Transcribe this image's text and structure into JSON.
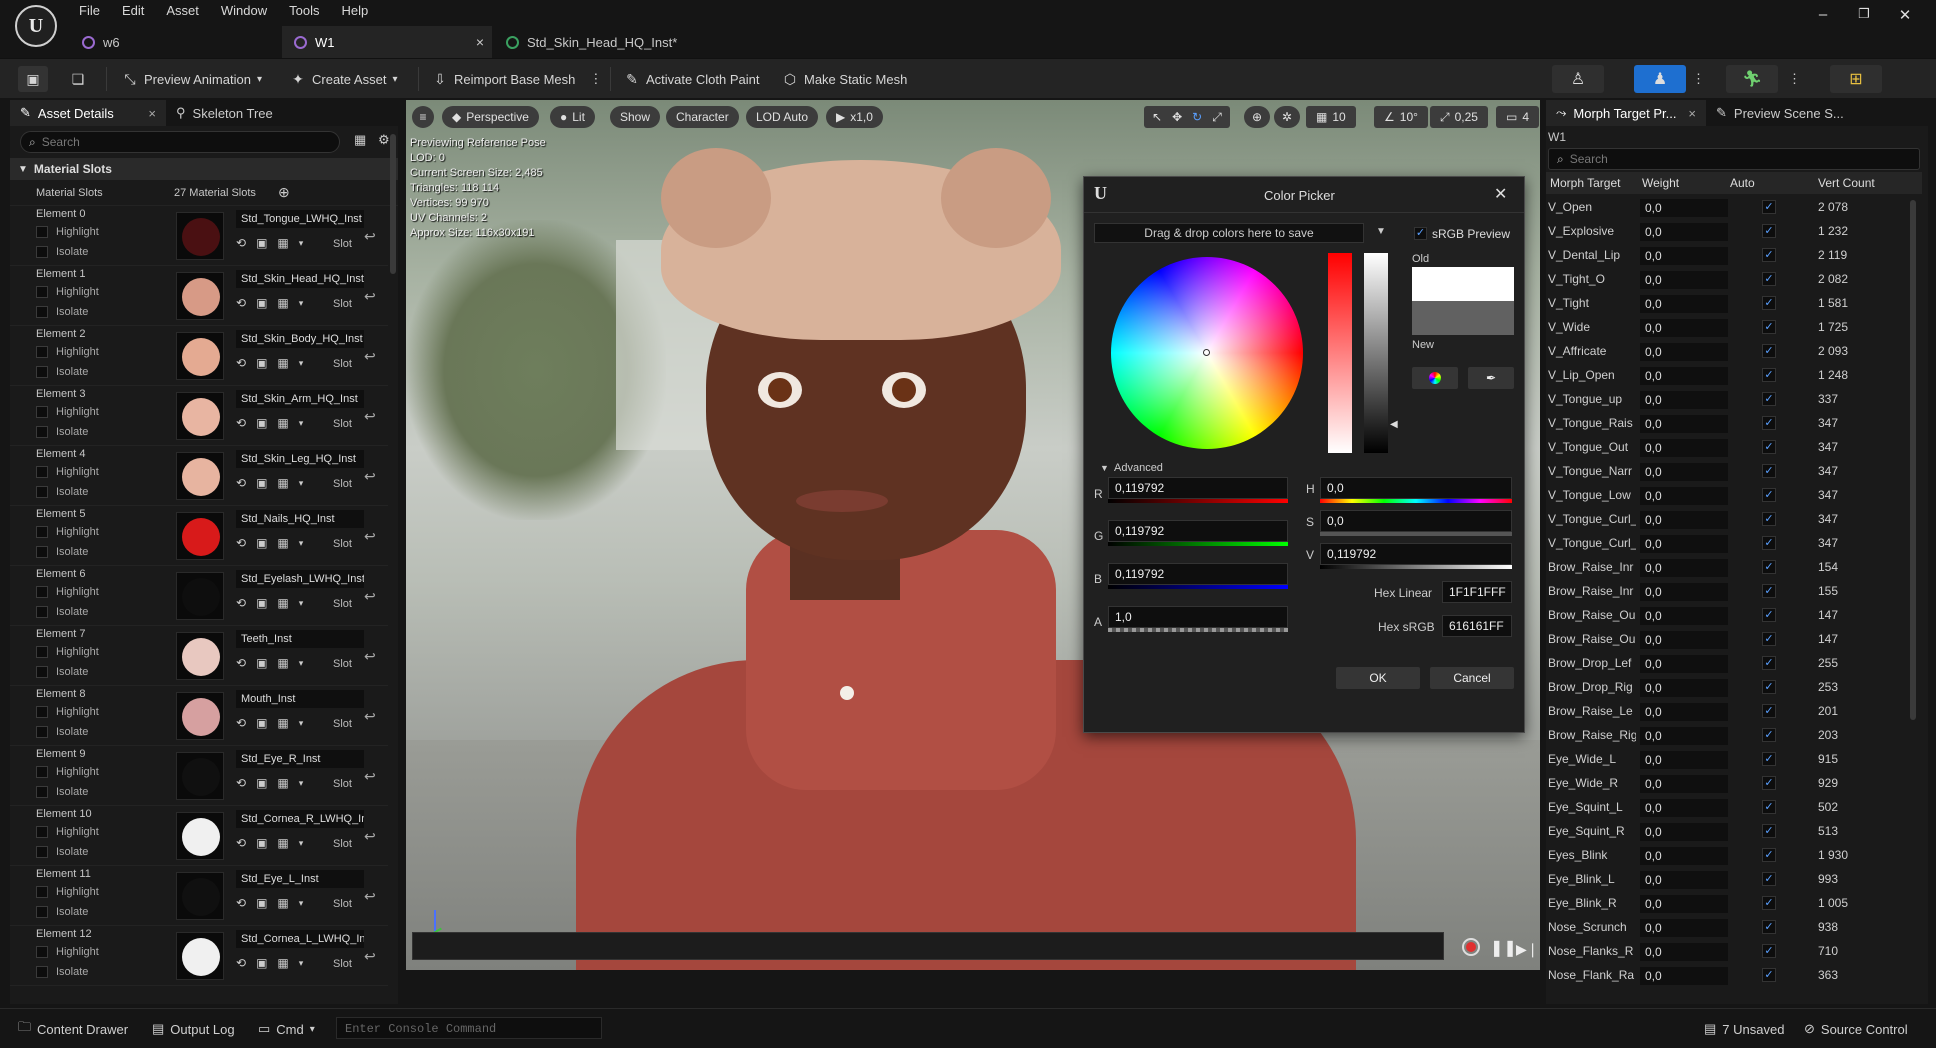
{
  "menu": [
    "File",
    "Edit",
    "Asset",
    "Window",
    "Tools",
    "Help"
  ],
  "doc_tabs": [
    {
      "label": "w6"
    },
    {
      "label": "W1"
    },
    {
      "label": "Std_Skin_Head_HQ_Inst*"
    }
  ],
  "toolbar": {
    "preview_animation": "Preview Animation",
    "create_asset": "Create Asset",
    "reimport": "Reimport Base Mesh",
    "cloth_paint": "Activate Cloth Paint",
    "static_mesh": "Make Static Mesh"
  },
  "left_panel": {
    "tab_details": "Asset Details",
    "tab_skeleton": "Skeleton Tree",
    "search_placeholder": "Search",
    "section": "Material Slots",
    "material_slots_label": "Material Slots",
    "material_slots_count": "27 Material Slots",
    "highlight": "Highlight",
    "isolate": "Isolate",
    "slot": "Slot",
    "elements": [
      {
        "label": "Element 0",
        "material": "Std_Tongue_LWHQ_Inst",
        "color": "#4a1012"
      },
      {
        "label": "Element 1",
        "material": "Std_Skin_Head_HQ_Inst",
        "color": "#d79a86"
      },
      {
        "label": "Element 2",
        "material": "Std_Skin_Body_HQ_Inst",
        "color": "#e4aa92"
      },
      {
        "label": "Element 3",
        "material": "Std_Skin_Arm_HQ_Inst",
        "color": "#e8b5a2"
      },
      {
        "label": "Element 4",
        "material": "Std_Skin_Leg_HQ_Inst",
        "color": "#e7b4a0"
      },
      {
        "label": "Element 5",
        "material": "Std_Nails_HQ_Inst",
        "color": "#d81a1a"
      },
      {
        "label": "Element 6",
        "material": "Std_Eyelash_LWHQ_Inst",
        "color": "#0e0e0e"
      },
      {
        "label": "Element 7",
        "material": "Teeth_Inst",
        "color": "#e8c8c0"
      },
      {
        "label": "Element 8",
        "material": "Mouth_Inst",
        "color": "#d6a0a0"
      },
      {
        "label": "Element 9",
        "material": "Std_Eye_R_Inst",
        "color": "#101010"
      },
      {
        "label": "Element 10",
        "material": "Std_Cornea_R_LWHQ_Inst",
        "color": "#f0f0f0"
      },
      {
        "label": "Element 11",
        "material": "Std_Eye_L_Inst",
        "color": "#101010"
      },
      {
        "label": "Element 12",
        "material": "Std_Cornea_L_LWHQ_Inst",
        "color": "#f0f0f0"
      }
    ]
  },
  "viewport": {
    "perspective": "Perspective",
    "lit": "Lit",
    "show": "Show",
    "character": "Character",
    "lod": "LOD Auto",
    "speed": "x1,0",
    "grid": "10",
    "angle": "10°",
    "scale": "0,25",
    "camera": "4",
    "stats": [
      "Previewing Reference Pose",
      "LOD: 0",
      "Current Screen Size: 2,485",
      "Triangles: 118 114",
      "Vertices: 99 970",
      "UV Channels: 2",
      "Approx Size: 116x30x191"
    ]
  },
  "color_picker": {
    "title": "Color Picker",
    "dragdrop": "Drag & drop colors here to save",
    "srgb_preview": "sRGB Preview",
    "old": "Old",
    "new": "New",
    "advanced": "Advanced",
    "r_label": "R",
    "r": "0,119792",
    "g_label": "G",
    "g": "0,119792",
    "b_label": "B",
    "b": "0,119792",
    "a_label": "A",
    "a": "1,0",
    "h_label": "H",
    "h": "0,0",
    "s_label": "S",
    "s": "0,0",
    "v_label": "V",
    "v": "0,119792",
    "hex_linear_label": "Hex Linear",
    "hex_linear": "1F1F1FFF",
    "hex_srgb_label": "Hex sRGB",
    "hex_srgb": "616161FF",
    "ok": "OK",
    "cancel": "Cancel",
    "old_color": "#ffffff",
    "new_color": "#616161"
  },
  "right_panel": {
    "tab_morph": "Morph Target Pr...",
    "tab_scene": "Preview Scene S...",
    "asset": "W1",
    "search_placeholder": "Search",
    "col_morph": "Morph Target",
    "col_weight": "Weight",
    "col_auto": "Auto",
    "col_vert": "Vert Count",
    "rows": [
      {
        "name": "V_Open",
        "weight": "0,0",
        "vert": "2 078"
      },
      {
        "name": "V_Explosive",
        "weight": "0,0",
        "vert": "1 232"
      },
      {
        "name": "V_Dental_Lip",
        "weight": "0,0",
        "vert": "2 119"
      },
      {
        "name": "V_Tight_O",
        "weight": "0,0",
        "vert": "2 082"
      },
      {
        "name": "V_Tight",
        "weight": "0,0",
        "vert": "1 581"
      },
      {
        "name": "V_Wide",
        "weight": "0,0",
        "vert": "1 725"
      },
      {
        "name": "V_Affricate",
        "weight": "0,0",
        "vert": "2 093"
      },
      {
        "name": "V_Lip_Open",
        "weight": "0,0",
        "vert": "1 248"
      },
      {
        "name": "V_Tongue_up",
        "weight": "0,0",
        "vert": "337"
      },
      {
        "name": "V_Tongue_Rais",
        "weight": "0,0",
        "vert": "347"
      },
      {
        "name": "V_Tongue_Out",
        "weight": "0,0",
        "vert": "347"
      },
      {
        "name": "V_Tongue_Narr",
        "weight": "0,0",
        "vert": "347"
      },
      {
        "name": "V_Tongue_Low",
        "weight": "0,0",
        "vert": "347"
      },
      {
        "name": "V_Tongue_Curl_",
        "weight": "0,0",
        "vert": "347"
      },
      {
        "name": "V_Tongue_Curl_",
        "weight": "0,0",
        "vert": "347"
      },
      {
        "name": "Brow_Raise_Inr",
        "weight": "0,0",
        "vert": "154"
      },
      {
        "name": "Brow_Raise_Inr",
        "weight": "0,0",
        "vert": "155"
      },
      {
        "name": "Brow_Raise_Ou",
        "weight": "0,0",
        "vert": "147"
      },
      {
        "name": "Brow_Raise_Ou",
        "weight": "0,0",
        "vert": "147"
      },
      {
        "name": "Brow_Drop_Lef",
        "weight": "0,0",
        "vert": "255"
      },
      {
        "name": "Brow_Drop_Rig",
        "weight": "0,0",
        "vert": "253"
      },
      {
        "name": "Brow_Raise_Le",
        "weight": "0,0",
        "vert": "201"
      },
      {
        "name": "Brow_Raise_Rig",
        "weight": "0,0",
        "vert": "203"
      },
      {
        "name": "Eye_Wide_L",
        "weight": "0,0",
        "vert": "915"
      },
      {
        "name": "Eye_Wide_R",
        "weight": "0,0",
        "vert": "929"
      },
      {
        "name": "Eye_Squint_L",
        "weight": "0,0",
        "vert": "502"
      },
      {
        "name": "Eye_Squint_R",
        "weight": "0,0",
        "vert": "513"
      },
      {
        "name": "Eyes_Blink",
        "weight": "0,0",
        "vert": "1 930"
      },
      {
        "name": "Eye_Blink_L",
        "weight": "0,0",
        "vert": "993"
      },
      {
        "name": "Eye_Blink_R",
        "weight": "0,0",
        "vert": "1 005"
      },
      {
        "name": "Nose_Scrunch",
        "weight": "0,0",
        "vert": "938"
      },
      {
        "name": "Nose_Flanks_R",
        "weight": "0,0",
        "vert": "710"
      },
      {
        "name": "Nose_Flank_Ra",
        "weight": "0,0",
        "vert": "363"
      }
    ]
  },
  "bottom": {
    "content_drawer": "Content Drawer",
    "output_log": "Output Log",
    "cmd": "Cmd",
    "console_placeholder": "Enter Console Command",
    "unsaved": "7 Unsaved",
    "source_control": "Source Control"
  }
}
